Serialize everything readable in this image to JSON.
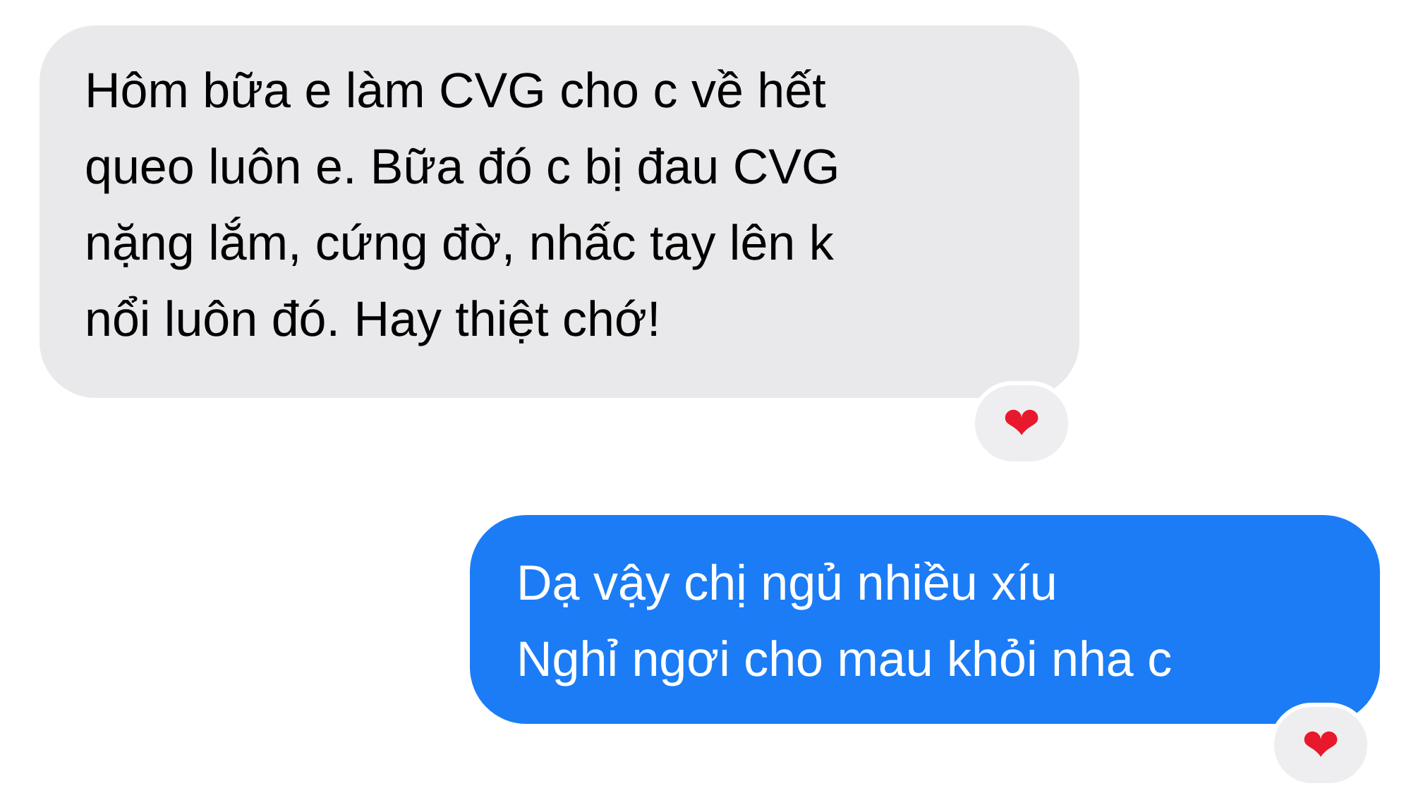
{
  "messages": [
    {
      "kind": "received",
      "lines": [
        "Hôm bữa e làm CVG cho c về hết",
        "queo luôn e. Bữa đó c bị đau CVG",
        "nặng lắm, cứng đờ, nhấc tay lên k",
        "nổi luôn đó. Hay thiệt chớ!"
      ],
      "reaction": "❤️"
    },
    {
      "kind": "sent",
      "lines": [
        "Dạ vậy chị ngủ nhiều xíu",
        "Nghỉ ngơi cho mau khỏi nha c"
      ],
      "reaction": "❤️"
    }
  ]
}
